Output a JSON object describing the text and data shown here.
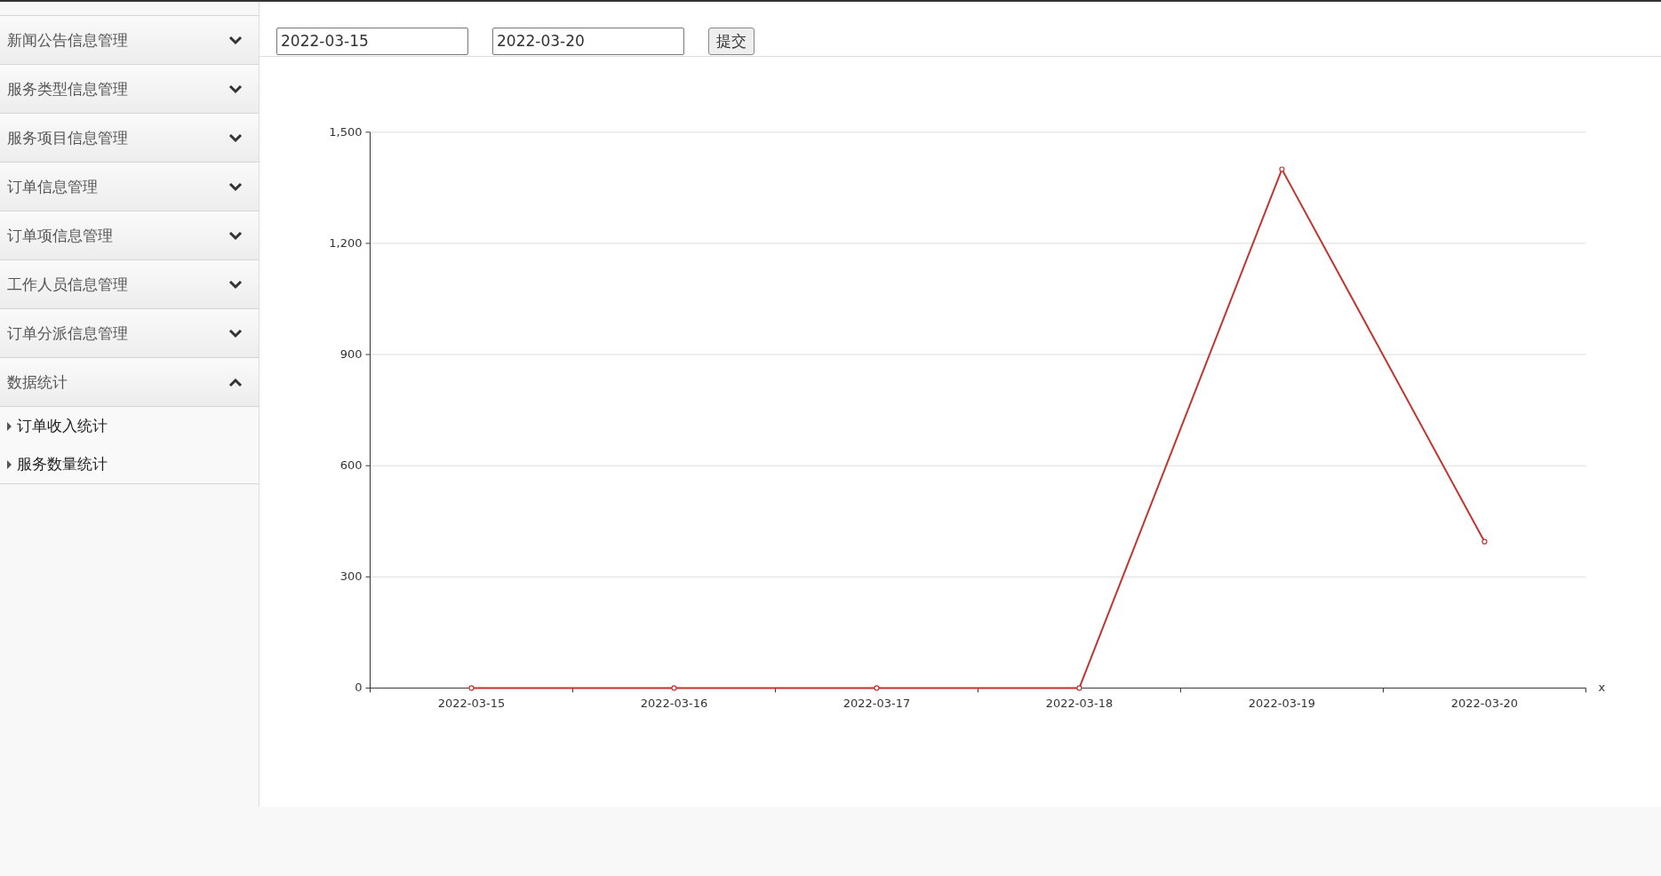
{
  "sidebar": {
    "items": [
      {
        "label": "新闻公告信息管理",
        "expanded": false
      },
      {
        "label": "服务类型信息管理",
        "expanded": false
      },
      {
        "label": "服务项目信息管理",
        "expanded": false
      },
      {
        "label": "订单信息管理",
        "expanded": false
      },
      {
        "label": "订单项信息管理",
        "expanded": false
      },
      {
        "label": "工作人员信息管理",
        "expanded": false
      },
      {
        "label": "订单分派信息管理",
        "expanded": false
      },
      {
        "label": "数据统计",
        "expanded": true,
        "children": [
          {
            "label": "订单收入统计"
          },
          {
            "label": "服务数量统计"
          }
        ]
      }
    ]
  },
  "filter": {
    "start_date": "2022-03-15",
    "end_date": "2022-03-20",
    "submit": "提交"
  },
  "chart_data": {
    "type": "line",
    "xlabel": "x",
    "categories": [
      "2022-03-15",
      "2022-03-16",
      "2022-03-17",
      "2022-03-18",
      "2022-03-19",
      "2022-03-20"
    ],
    "grid": true,
    "series": [
      {
        "color": "#c23531",
        "marker": true,
        "values": [
          0,
          0,
          0,
          0,
          1400,
          395
        ]
      }
    ],
    "ylim": [
      0,
      1500
    ],
    "yticks": [
      {
        "value": 0,
        "label": "0"
      },
      {
        "value": 300,
        "label": "300"
      },
      {
        "value": 600,
        "label": "600"
      },
      {
        "value": 900,
        "label": "900"
      },
      {
        "value": 1200,
        "label": "1,200"
      },
      {
        "value": 1500,
        "label": "1,500"
      }
    ]
  }
}
